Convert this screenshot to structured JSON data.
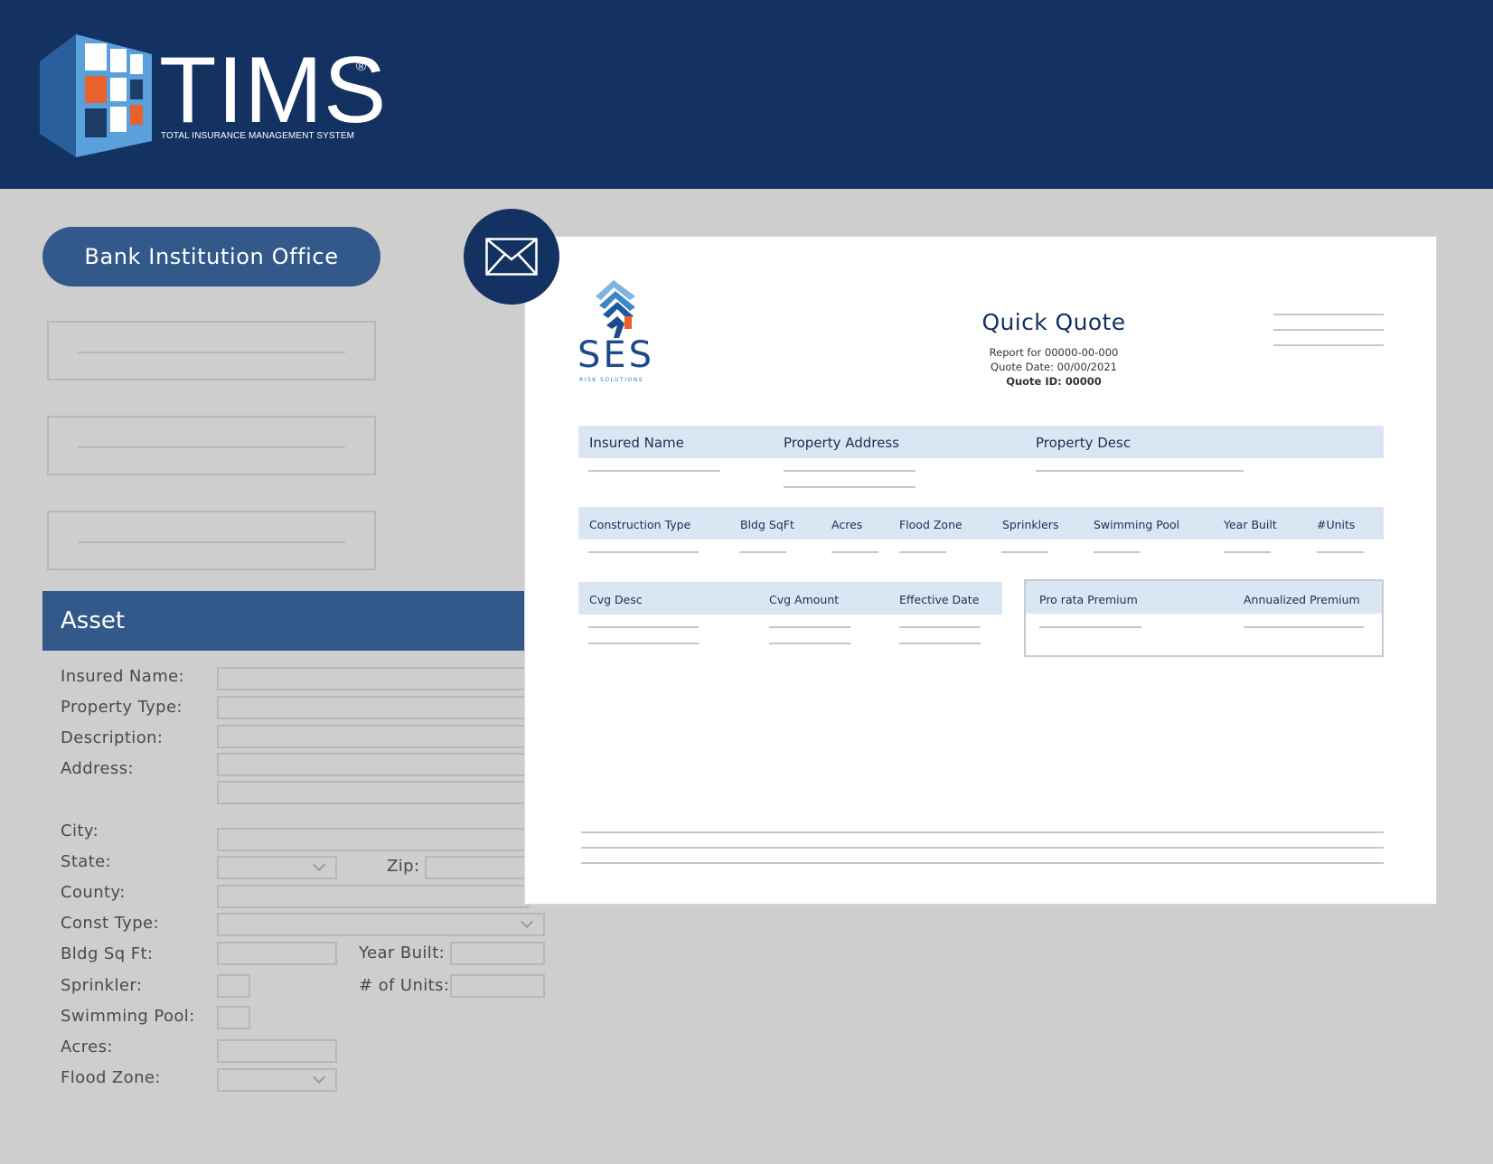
{
  "header": {
    "brand": "TIMS",
    "registered": "®",
    "tagline": "TOTAL INSURANCE MANAGEMENT SYSTEM",
    "bg_color": "#133261"
  },
  "sidebar": {
    "office_button": "Bank Institution Office",
    "section_title": "Asset"
  },
  "asset_form": {
    "insured_name": "Insured Name:",
    "property_type": "Property Type:",
    "description": "Description:",
    "address": "Address:",
    "city": "City:",
    "state": "State:",
    "zip": "Zip:",
    "county": "County:",
    "const_type": "Const Type:",
    "bldg_sq_ft": "Bldg Sq Ft:",
    "year_built": "Year Built:",
    "sprinkler": "Sprinkler:",
    "num_units": "# of Units:",
    "swimming_pool": "Swimming Pool:",
    "acres": "Acres:",
    "flood_zone": "Flood Zone:"
  },
  "mail": {
    "icon": "envelope-icon"
  },
  "quote": {
    "logo_text": "SES",
    "logo_sub": "RISK SOLUTIONS",
    "title": "Quick Quote",
    "report_for": "Report for 00000-00-000",
    "quote_date": "Quote Date: 00/00/2021",
    "quote_id": "Quote ID: 00000",
    "section1_headers": [
      "Insured Name",
      "Property Address",
      "Property Desc"
    ],
    "section2_headers": [
      "Construction Type",
      "Bldg SqFt",
      "Acres",
      "Flood Zone",
      "Sprinklers",
      "Swimming Pool",
      "Year Built",
      "#Units"
    ],
    "section3_headers": [
      "Cvg Desc",
      "Cvg Amount",
      "Effective Date"
    ],
    "premium_headers": [
      "Pro rata Premium",
      "Annualized Premium"
    ]
  },
  "colors": {
    "primary_navy": "#133261",
    "accent_blue": "#33598a",
    "table_header": "#dbe6f4",
    "background": "#cfcecf"
  }
}
